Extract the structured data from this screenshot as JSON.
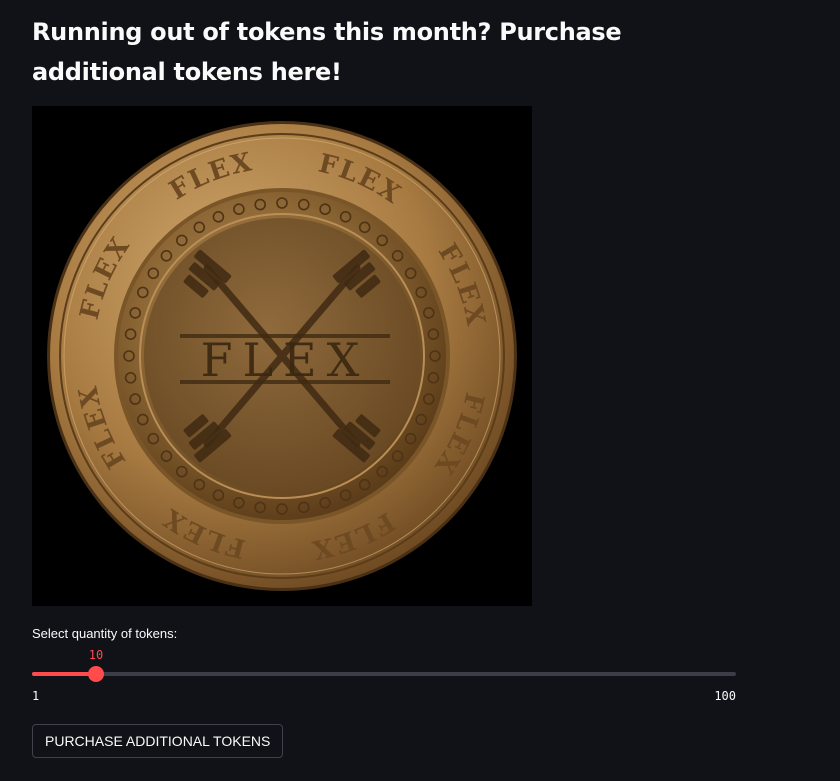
{
  "header": {
    "title": "Running out of tokens this month? Purchase additional tokens here!"
  },
  "coin_image": {
    "rim_text": "FLEX",
    "center_text": "FLEX",
    "colors": {
      "gold_light": "#c9a26a",
      "gold_dark": "#6e4a22",
      "background": "#000000"
    }
  },
  "slider": {
    "label": "Select quantity of tokens:",
    "value": 10,
    "value_text": "10",
    "min": 1,
    "max": 100,
    "min_text": "1",
    "max_text": "100",
    "accent": "#ff4b4b"
  },
  "purchase_button": {
    "label": "PURCHASE ADDITIONAL TOKENS"
  }
}
